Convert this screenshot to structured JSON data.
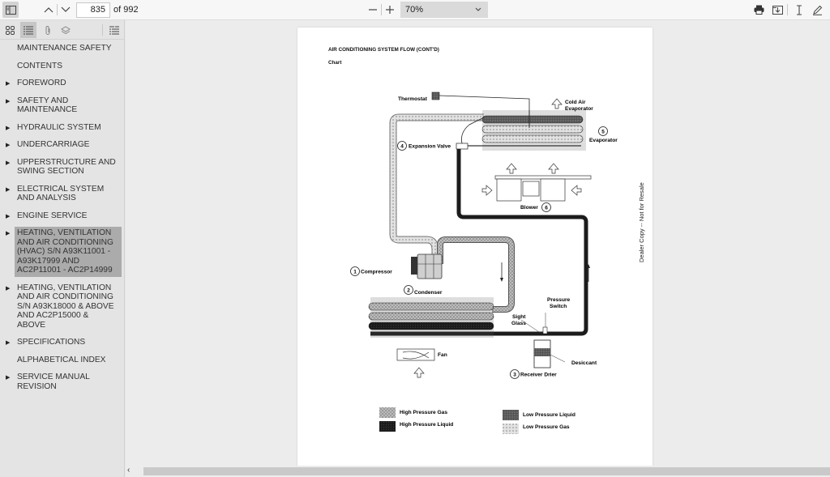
{
  "toolbar": {
    "page_current": "835",
    "page_total_label": "of 992",
    "zoom_value": "70%",
    "icons": {
      "sidebar_toggle": "sidebar-toggle-icon",
      "prev_page": "chevron-up-icon",
      "next_page": "chevron-down-icon",
      "zoom_out": "minus-icon",
      "zoom_in": "plus-icon",
      "print": "print-icon",
      "save": "save-icon",
      "text_select": "text-cursor-icon",
      "draw": "pen-icon"
    }
  },
  "sidebar": {
    "tools": [
      "thumbnails-icon",
      "outline-icon",
      "attachments-icon",
      "layers-icon",
      "outline-options-icon"
    ],
    "outline": [
      {
        "label": "MAINTENANCE SAFETY",
        "arrow": false,
        "selected": false
      },
      {
        "label": "CONTENTS",
        "arrow": false,
        "selected": false
      },
      {
        "label": "FOREWORD",
        "arrow": true,
        "selected": false
      },
      {
        "label": "SAFETY AND MAINTENANCE",
        "arrow": true,
        "selected": false
      },
      {
        "label": "HYDRAULIC SYSTEM",
        "arrow": true,
        "selected": false
      },
      {
        "label": "UNDERCARRIAGE",
        "arrow": true,
        "selected": false
      },
      {
        "label": "UPPERSTRUCTURE AND SWING SECTION",
        "arrow": true,
        "selected": false
      },
      {
        "label": "ELECTRICAL SYSTEM AND ANALYSIS",
        "arrow": true,
        "selected": false
      },
      {
        "label": "ENGINE SERVICE",
        "arrow": true,
        "selected": false
      },
      {
        "label": "HEATING, VENTILATION AND AIR CONDITIONING (HVAC) S/N A93K11001 - A93K17999 AND AC2P11001 - AC2P14999",
        "arrow": true,
        "selected": true
      },
      {
        "label": "HEATING, VENTILATION AND AIR CONDITIONING S/N A93K18000 & ABOVE AND AC2P15000 & ABOVE",
        "arrow": true,
        "selected": false
      },
      {
        "label": "SPECIFICATIONS",
        "arrow": true,
        "selected": false
      },
      {
        "label": "ALPHABETICAL INDEX",
        "arrow": false,
        "selected": false
      },
      {
        "label": "SERVICE MANUAL REVISION",
        "arrow": true,
        "selected": false
      }
    ]
  },
  "document": {
    "title": "AIR CONDITIONING SYSTEM FLOW (CONT'D)",
    "subtitle": "Chart",
    "watermark": "Dealer Copy -- Not for Resale",
    "diagram": {
      "labels": {
        "thermostat": "Thermostat",
        "cold_air": "Cold Air",
        "cold_air_evap": "Evaporator",
        "evaporator": "Evaporator",
        "expansion_valve": "Expansion Valve",
        "blower": "Blower",
        "compressor": "Compressor",
        "condenser": "Condenser",
        "pressure": "Pressure",
        "switch": "Switch",
        "sight": "Sight",
        "glass": "Glass",
        "desiccant": "Desiccant",
        "receiver_drier": "Receiver Drier",
        "fan": "Fan"
      },
      "numbers": {
        "compressor": "1",
        "condenser": "2",
        "receiver_drier": "3",
        "expansion_valve": "4",
        "evaporator": "5",
        "blower": "6"
      },
      "legend": [
        {
          "label": "High Pressure Gas",
          "pattern": "hpgas"
        },
        {
          "label": "High Pressure Liquid",
          "pattern": "hpliq"
        },
        {
          "label": "Low Pressure Liquid",
          "pattern": "lpliq"
        },
        {
          "label": "Low Pressure Gas",
          "pattern": "lpgas"
        }
      ]
    }
  }
}
